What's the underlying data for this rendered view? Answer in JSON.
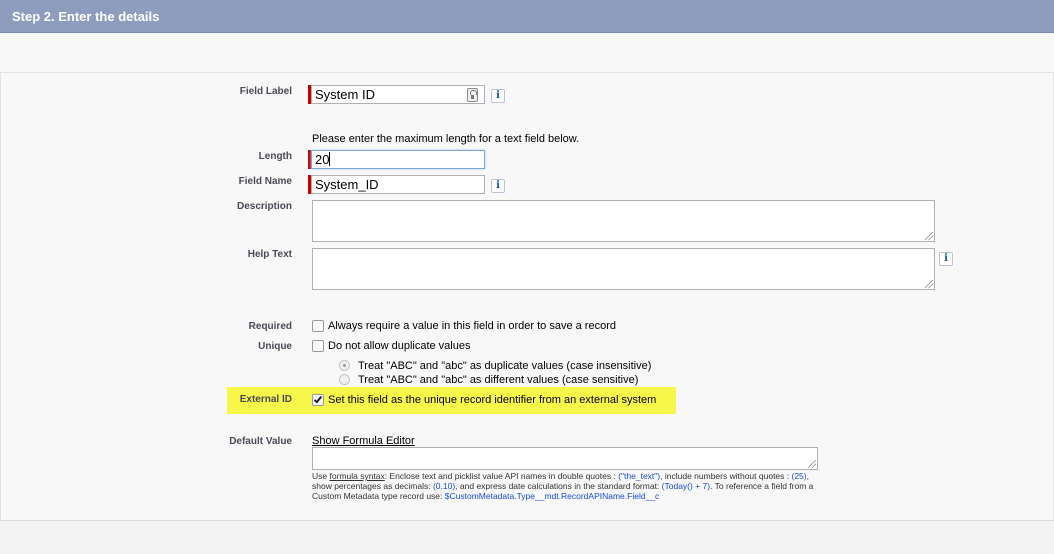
{
  "header": {
    "title": "Step 2. Enter the details"
  },
  "fields": {
    "field_label": {
      "label": "Field Label",
      "value": "System ID"
    },
    "length_hint": "Please enter the maximum length for a text field below.",
    "length": {
      "label": "Length",
      "value": "20"
    },
    "field_name": {
      "label": "Field Name",
      "value": "System_ID"
    },
    "description": {
      "label": "Description",
      "value": ""
    },
    "help_text": {
      "label": "Help Text",
      "value": ""
    },
    "required": {
      "label": "Required",
      "option": "Always require a value in this field in order to save a record"
    },
    "unique": {
      "label": "Unique",
      "option": "Do not allow duplicate values",
      "radio_insensitive": "Treat \"ABC\" and \"abc\" as duplicate values (case insensitive)",
      "radio_sensitive": "Treat \"ABC\" and \"abc\" as different values (case sensitive)"
    },
    "external_id": {
      "label": "External ID",
      "option": "Set this field as the unique record identifier from an external system",
      "checked": true
    },
    "default_value": {
      "label": "Default Value",
      "formula_link": "Show Formula Editor",
      "help": {
        "use": "Use ",
        "formula_syntax": "formula syntax",
        "part1": ": Enclose text and picklist value API names in double quotes : ",
        "code1": "(\"the_text\")",
        "part2": ", include numbers without quotes : ",
        "code2": "(25)",
        "part3": ", show percentages as decimals: ",
        "code3": "(0.10)",
        "part4": ", and express date calculations in the standard format: ",
        "code4": "(Today() + 7)",
        "part5": ". To reference a field from a Custom Metadata type record use: ",
        "code5": "$CustomMetadata.Type__mdt.RecordAPIName.Field__c"
      }
    }
  },
  "colors": {
    "header_bg": "#8e9dbe",
    "required_bar": "#cc0000",
    "highlight": "#f7f74a",
    "code_blue": "#1a4ad6"
  },
  "icons": {
    "lock": "lock-icon",
    "info": "info-icon",
    "check": "check-icon"
  }
}
